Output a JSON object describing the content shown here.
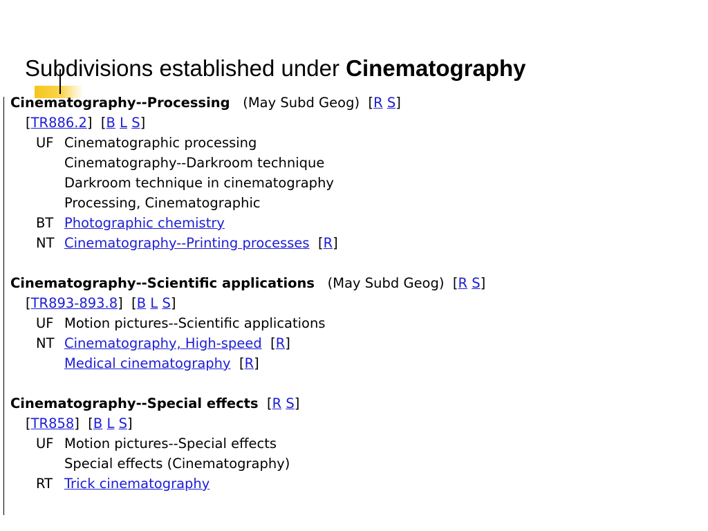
{
  "title": {
    "prefix": "Subdivisions established under ",
    "bold": "Cinematography"
  },
  "entries": [
    {
      "heading": "Cinematography--Processing",
      "note": "(May Subd Geog)",
      "refs": [
        "R",
        "S"
      ],
      "classification": "TR886.2",
      "class_links": [
        "B",
        "L",
        "S"
      ],
      "uf_label": "UF",
      "uf": [
        "Cinematographic processing",
        "Cinematography--Darkroom technique",
        "Darkroom technique in cinematography",
        "Processing, Cinematographic"
      ],
      "bt_label": "BT",
      "bt": "Photographic chemistry",
      "nt_label": "NT",
      "nt": [
        {
          "text": "Cinematography--Printing processes",
          "ref": "R"
        }
      ]
    },
    {
      "heading": "Cinematography--Scientific applications",
      "note": "(May Subd Geog)",
      "refs": [
        "R",
        "S"
      ],
      "classification": "TR893-893.8",
      "class_links": [
        "B",
        "L",
        "S"
      ],
      "uf_label": "UF",
      "uf": [
        "Motion pictures--Scientific applications"
      ],
      "nt_label": "NT",
      "nt": [
        {
          "text": "Cinematography, High-speed",
          "ref": "R"
        },
        {
          "text": "Medical cinematography",
          "ref": "R"
        }
      ]
    },
    {
      "heading": "Cinematography--Special effects",
      "refs": [
        "R",
        "S"
      ],
      "classification": "TR858",
      "class_links": [
        "B",
        "L",
        "S"
      ],
      "uf_label": "UF",
      "uf": [
        "Motion pictures--Special effects",
        "Special effects (Cinematography)"
      ],
      "rt_label": "RT",
      "rt": "Trick cinematography"
    }
  ],
  "colors": {
    "link": "#1c1cd6",
    "accent": "#f7c51b"
  }
}
